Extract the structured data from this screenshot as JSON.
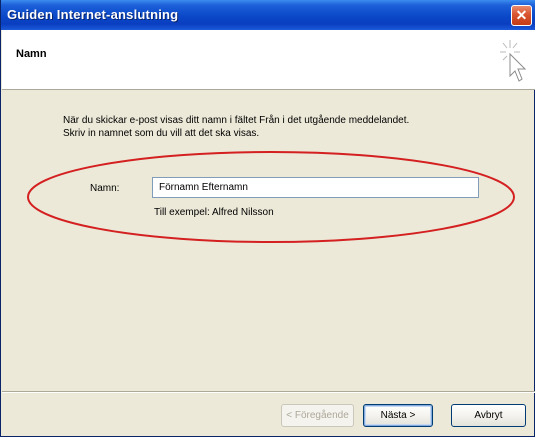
{
  "window": {
    "title": "Guiden Internet-anslutning",
    "close_glyph": "✕"
  },
  "header": {
    "title": "Namn",
    "icon": "wizard-cursor-icon"
  },
  "content": {
    "description_line1": "När du skickar e-post visas ditt namn i fältet Från i det utgående meddelandet.",
    "description_line2": "Skriv in namnet som du vill att det ska visas.",
    "name_label": "Namn:",
    "name_value": "Förnamn Efternamn",
    "example_text": "Till exempel: Alfred Nilsson"
  },
  "annotation": {
    "ellipse_color": "#d42020"
  },
  "buttons": {
    "back": "< Föregående",
    "next": "Nästa >",
    "cancel": "Avbryt"
  }
}
